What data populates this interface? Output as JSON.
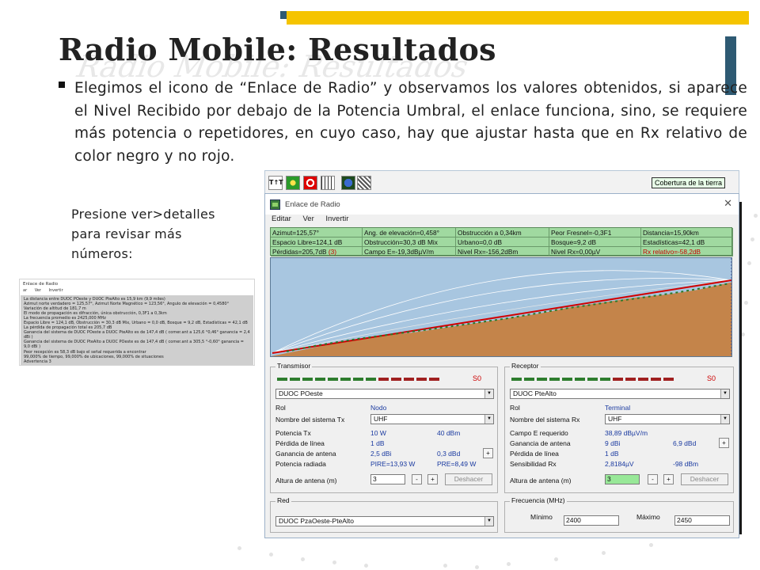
{
  "slide": {
    "title": "Radio Mobile: Resultados",
    "bullet": "Elegimos el icono de “Enlace de Radio” y observamos los valores obtenidos, si aparece el Nivel Recibido por debajo de la Potencia Umbral, el enlace funciona, sino, se requiere más potencia o repetidores, en cuyo caso, hay que ajustar hasta que en Rx relativo de color negro y no rojo.",
    "note": "Presione ver>detalles para revisar más números:",
    "accent_color": "#f5c400",
    "dark_accent_color": "#2e5a73"
  },
  "details": {
    "title": "Enlace de Radio",
    "menu": [
      "ar",
      "Ver",
      "Invertir"
    ],
    "lines": [
      "La distancia entre DUOC POeste y DUOC PteAlto es 15,9 km (9,9 miles)",
      "Azimut norte verdadero = 125,57°, Azimut Norte Magnético = 123,56°, Angulo de elevación = 0,4580°",
      "Variación de altitud de 181,7 m",
      "El modo de propagación es difracción, única obstrucción, 0,3F1 a 0,3km",
      "La frecuencia promedio es 2425,000 MHz",
      "Espacio Libre = 124,1 dB, Obstrucción = 30,3 dB Mix, Urbano = 0,0 dB, Bosque = 9,2 dB, Estadísticas = 42,1 dB",
      "La pérdida de propagación total es 205,7 dB",
      "Ganancia del sistema de DUOC POeste a DUOC PteAlto es de 147,4 dB ( comer.ant a 125,6 °0,46° ganancia = 2,4 dBi )",
      "Ganancia del sistema de DUOC PteAlto a DUOC POeste es de 147,4 dB ( comer.ant a 305,5 °-0,60° ganancia = 9,0 dBi )",
      "Peor recepción es 58,3 dB bajo el señal requerida a encontrar",
      "99,000% de tiempo, 99,000% de ubicaciones, 99,000% de situaciones",
      "Advertencia 3"
    ]
  },
  "toolbar": {
    "label": "Cobertura de la tierra",
    "icons": [
      "tt-icon",
      "globe-green-icon",
      "target-icon",
      "grid-icon",
      "world-icon",
      "pattern-icon"
    ]
  },
  "window": {
    "title": "Enlace de Radio",
    "close": "✕",
    "menu": [
      "Editar",
      "Ver",
      "Invertir"
    ],
    "stats": [
      [
        "Azimut=125,57°",
        "Ang. de elevación=0,458°",
        "Obstrucción a 0,34km",
        "Peor Fresnel=-0,3F1",
        "Distancia=15,90km"
      ],
      [
        "Espacio Libre=124,1 dB",
        "Obstrucción=30,3 dB Mix",
        "Urbano=0,0 dB",
        "Bosque=9,2 dB",
        "Estadísticas=42,1 dB"
      ],
      [
        "Pérdidas=205,7dB (3)",
        "Campo E=-19,3dBµV/m",
        "Nivel Rx=-156,2dBm",
        "Nivel Rx=0,00µV",
        "Rx relativo=-58,2dB"
      ]
    ],
    "terrain_color": "#c4844a",
    "sky_color": "#a8c6e0",
    "path_color": "#d00000"
  },
  "tx": {
    "group": "Transmisor",
    "meter_value": "S0",
    "station": "DUOC POeste",
    "rol_label": "Rol",
    "rol_value": "Nodo",
    "system_label": "Nombre del sistema Tx",
    "system_value": "UHF",
    "power_label": "Potencia Tx",
    "power_w": "10 W",
    "power_dbm": "40 dBm",
    "loss_label": "Pérdida de línea",
    "loss_value": "1 dB",
    "gain_label": "Ganancia de antena",
    "gain_dbi": "2,5 dBi",
    "gain_dbd": "0,3 dBd",
    "radiated_label": "Potencia radiada",
    "pire_w": "PIRE=13,93 W",
    "pre_w": "PRE=8,49 W",
    "height_label": "Altura de antena (m)",
    "height_value": "3",
    "undo": "Deshacer"
  },
  "rx": {
    "group": "Receptor",
    "meter_value": "S0",
    "station": "DUOC PteAlto",
    "rol_label": "Rol",
    "rol_value": "Terminal",
    "system_label": "Nombre del sistema Rx",
    "system_value": "UHF",
    "field_label": "Campo E requerido",
    "field_value": "38,89 dBµV/m",
    "gain_label": "Ganancia de antena",
    "gain_dbi": "9 dBi",
    "gain_dbd": "6,9 dBd",
    "loss_label": "Pérdida de línea",
    "loss_value": "1 dB",
    "sens_label": "Sensibilidad Rx",
    "sens_uv": "2,8184µV",
    "sens_dbm": "-98 dBm",
    "height_label": "Altura de antena (m)",
    "height_value": "3",
    "undo": "Deshacer"
  },
  "net": {
    "group": "Red",
    "value": "DUOC PzaOeste-PteAlto"
  },
  "freq": {
    "group": "Frecuencia (MHz)",
    "min_label": "Mínimo",
    "min_value": "2400",
    "max_label": "Máximo",
    "max_value": "2450"
  },
  "buttons": {
    "minus": "-",
    "plus": "+",
    "arrow": "▼"
  }
}
